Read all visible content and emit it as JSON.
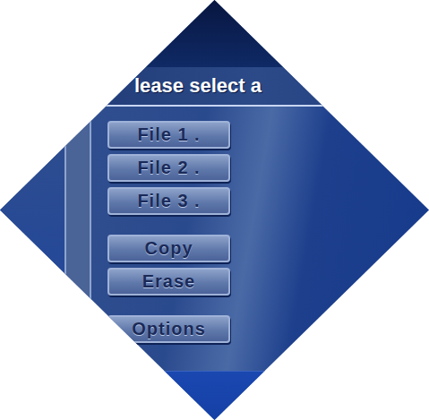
{
  "screen": {
    "title": "lease select a"
  },
  "file_slots": [
    {
      "label": "File 1 ."
    },
    {
      "label": "File 2 ."
    },
    {
      "label": "File 3 ."
    }
  ],
  "actions": [
    {
      "label": "Copy"
    },
    {
      "label": "Erase"
    }
  ],
  "options": {
    "label": "Options"
  }
}
